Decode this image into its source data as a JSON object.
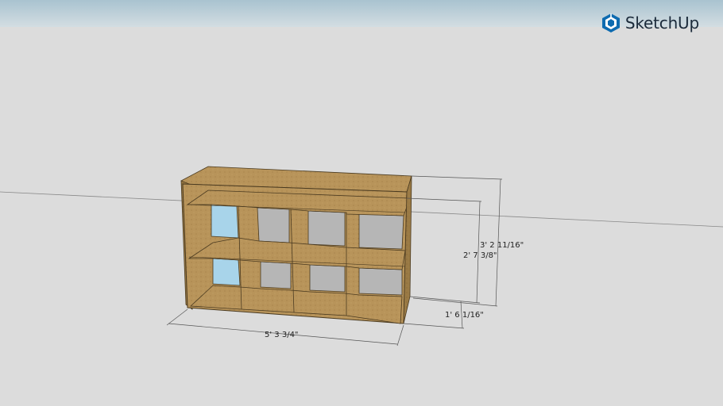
{
  "app": {
    "brand_name": "SketchUp",
    "logo_icon": "sketchup-logo-icon",
    "accent_color": "#0e6bb0"
  },
  "scene": {
    "model": "bookcase-cubby-shelf-2x4",
    "sky_color": "#b9cdd7",
    "ground_color": "#dcdcdc",
    "wood_color": "#b8945a",
    "glass_color": "#a8d4ea"
  },
  "dimensions": {
    "width": "5' 3 3/4\"",
    "overall_height": "3' 2 11/16\"",
    "height": "2' 7 3/8\"",
    "depth": "1' 6 1/16\""
  }
}
